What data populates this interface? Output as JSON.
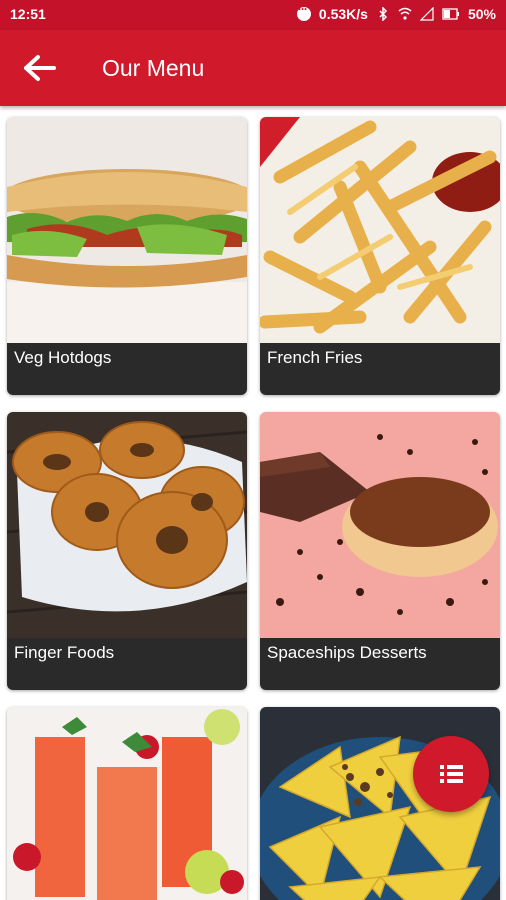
{
  "statusbar": {
    "time": "12:51",
    "network_speed": "0.53K/s",
    "battery": "50%"
  },
  "appbar": {
    "title": "Our Menu",
    "back_icon": "arrow-left-icon",
    "background": "#d0192b"
  },
  "menu": {
    "items": [
      {
        "label": "Veg Hotdogs"
      },
      {
        "label": "French Fries"
      },
      {
        "label": "Finger Foods"
      },
      {
        "label": "Spaceships Desserts"
      },
      {
        "label": "",
        "image": "drinks"
      },
      {
        "label": "",
        "image": "nachos"
      }
    ]
  },
  "fab": {
    "icon": "list-icon",
    "color": "#d0192b"
  }
}
